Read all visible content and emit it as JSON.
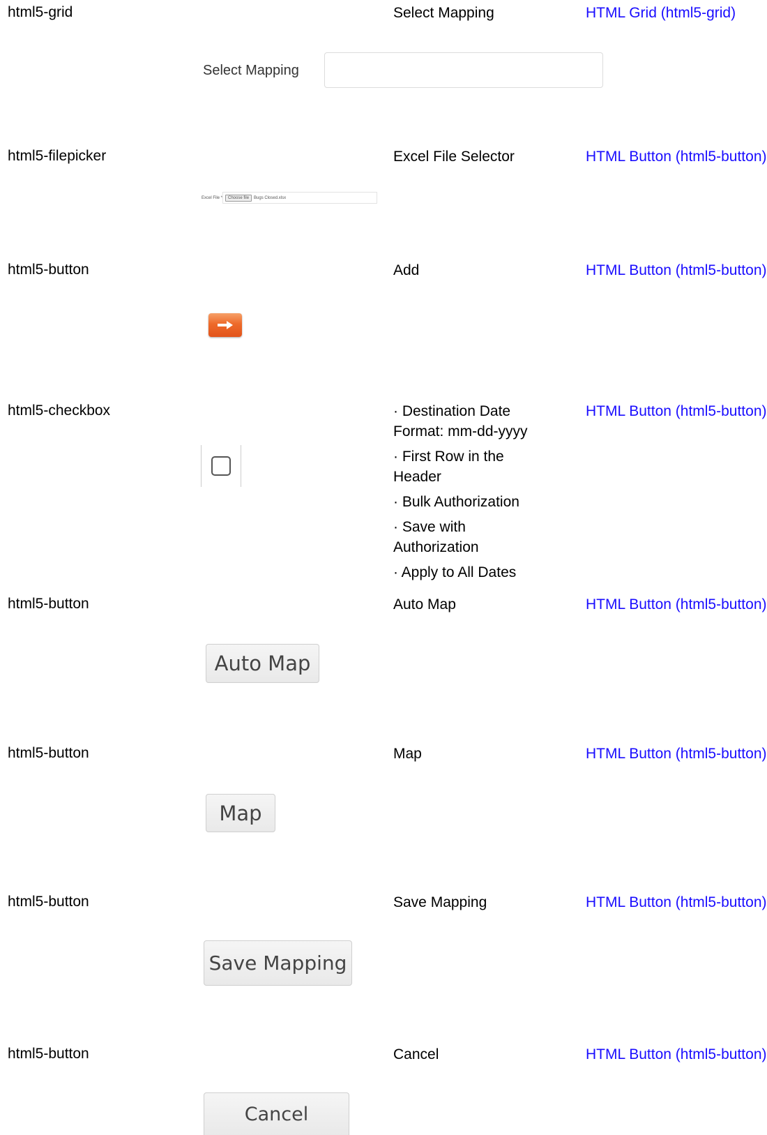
{
  "rows": [
    {
      "control": "html5-grid",
      "name": "Select Mapping",
      "link": "HTML Grid (html5-grid)"
    },
    {
      "control": "html5-filepicker",
      "name": "Excel File Selector",
      "link": "HTML Button (html5-button)"
    },
    {
      "control": "html5-button",
      "name": "Add",
      "link": "HTML Button (html5-button)"
    },
    {
      "control": "html5-checkbox",
      "name": "",
      "link": "HTML Button (html5-button)"
    },
    {
      "control": "html5-button",
      "name": "Auto Map",
      "link": "HTML Button (html5-button)"
    },
    {
      "control": "html5-button",
      "name": "Map",
      "link": "HTML Button (html5-button)"
    },
    {
      "control": "html5-button",
      "name": "Save Mapping",
      "link": "HTML Button (html5-button)"
    },
    {
      "control": "html5-button",
      "name": "Cancel",
      "link": "HTML Button (html5-button)"
    }
  ],
  "checkbox_names": [
    "· Destination Date Format: mm-dd-yyyy",
    "· First Row in the Header",
    "· Bulk Authorization",
    "· Save with Authorization",
    "· Apply to All Dates"
  ],
  "previews": {
    "select_mapping_label": "Select Mapping",
    "filepicker_label": "Excel File *",
    "filepicker_button": "Choose file",
    "filepicker_filename": "Bugs Closed.xlsx",
    "auto_map_button": "Auto Map",
    "map_button": "Map",
    "save_mapping_button": "Save Mapping",
    "cancel_button": "Cancel"
  },
  "colors": {
    "link": "#1a0dff",
    "add_button": "#ee6a2a"
  }
}
